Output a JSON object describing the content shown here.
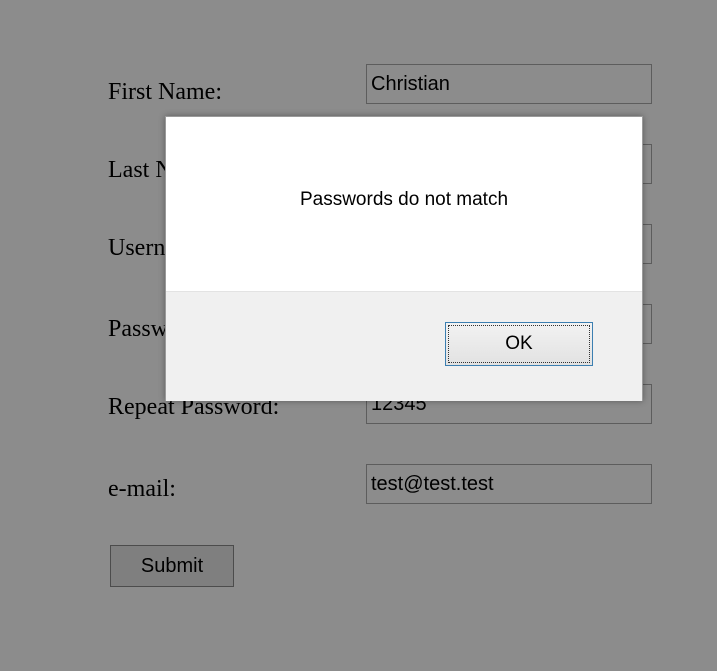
{
  "form": {
    "fields": [
      {
        "label": "First Name:",
        "value": "Christian"
      },
      {
        "label": "Last Name:",
        "value": ""
      },
      {
        "label": "Username:",
        "value": ""
      },
      {
        "label": "Password:",
        "value": ""
      },
      {
        "label": "Repeat Password:",
        "value": "12345"
      },
      {
        "label": "e-mail:",
        "value": "test@test.test"
      }
    ],
    "submit_label": "Submit"
  },
  "dialog": {
    "message": "Passwords do not match",
    "ok_label": "OK"
  },
  "colors": {
    "overlay": "#000000",
    "dialog_footer": "#f0f0f0",
    "focus_border": "#3c7fb1"
  }
}
